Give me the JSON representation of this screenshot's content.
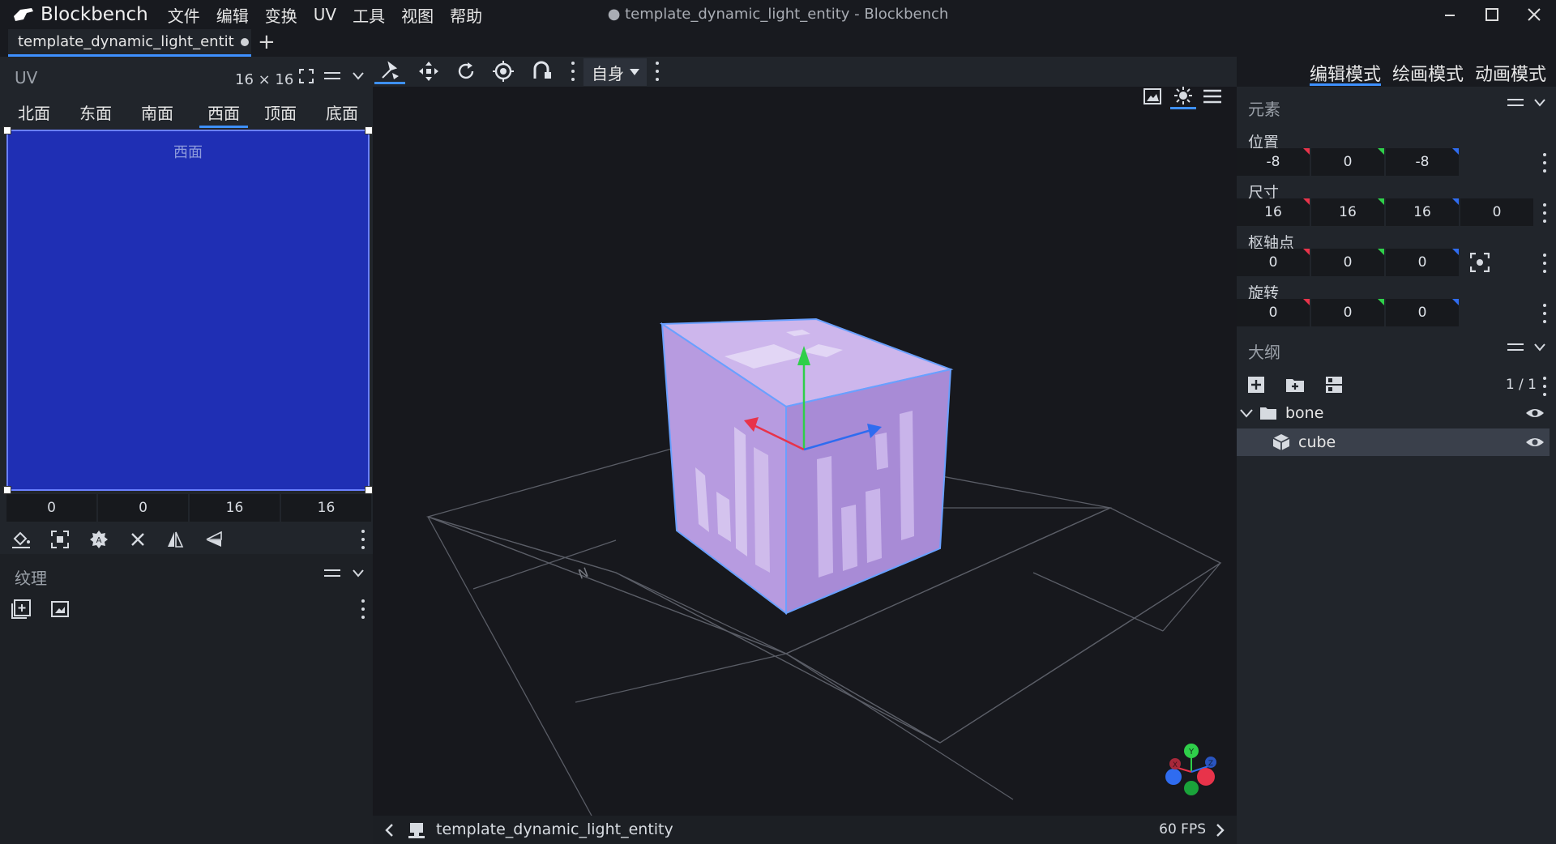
{
  "app": {
    "name": "Blockbench",
    "window_title": "● template_dynamic_light_entity - Blockbench",
    "menu": [
      "文件",
      "编辑",
      "变换",
      "UV",
      "工具",
      "视图",
      "帮助"
    ],
    "tab_label": "template_dynamic_light_entit",
    "new_tab": "+"
  },
  "uv_panel": {
    "title": "UV",
    "size": "16 × 16",
    "face_tabs": [
      "北面",
      "东面",
      "南面",
      "西面",
      "顶面",
      "底面"
    ],
    "active_face": "西面",
    "canvas_label": "西面",
    "fields": [
      "0",
      "0",
      "16",
      "16"
    ]
  },
  "texture_panel": {
    "title": "纹理"
  },
  "viewport": {
    "space_mode": "自身",
    "footer_name": "template_dynamic_light_entity",
    "fps": "60 FPS",
    "gizmo_labels": {
      "y": "Y",
      "x": "X",
      "z": "Z"
    }
  },
  "modes": [
    "编辑模式",
    "绘画模式",
    "动画模式"
  ],
  "element_panel": {
    "title": "元素",
    "position": {
      "label": "位置",
      "values": [
        "-8",
        "0",
        "-8"
      ]
    },
    "size": {
      "label": "尺寸",
      "values": [
        "16",
        "16",
        "16",
        "0"
      ]
    },
    "pivot": {
      "label": "枢轴点",
      "values": [
        "0",
        "0",
        "0"
      ]
    },
    "rotation": {
      "label": "旋转",
      "values": [
        "0",
        "0",
        "0"
      ]
    }
  },
  "outliner": {
    "title": "大纲",
    "count": "1 / 1",
    "items": [
      {
        "name": "bone",
        "type": "group"
      },
      {
        "name": "cube",
        "type": "cube"
      }
    ]
  },
  "colors": {
    "accent": "#3e90ff",
    "axis_x": "#e8334a",
    "axis_y": "#2fcf4a",
    "axis_z": "#2f6cf0",
    "uv_fill": "#1f2fb4",
    "cube_face": "#b89be0"
  }
}
